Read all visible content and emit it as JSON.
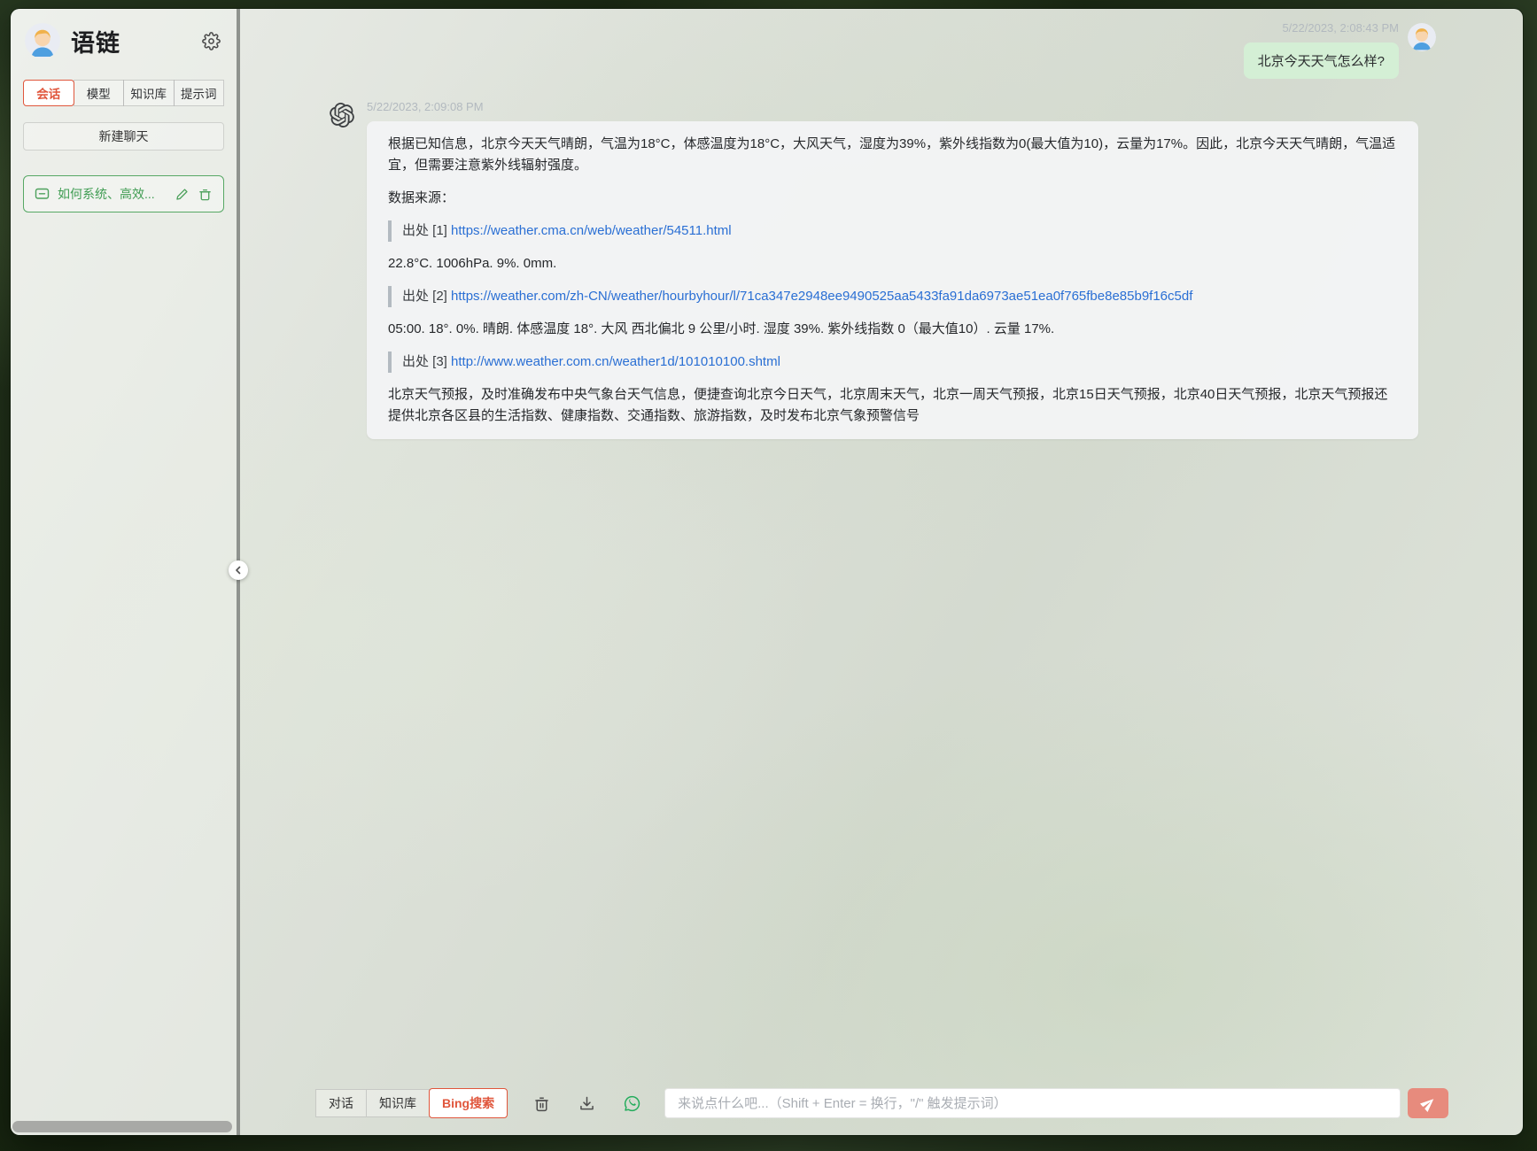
{
  "sidebar": {
    "app_title": "语链",
    "tabs": [
      {
        "label": "会话",
        "active": true
      },
      {
        "label": "模型",
        "active": false
      },
      {
        "label": "知识库",
        "active": false
      },
      {
        "label": "提示词",
        "active": false
      }
    ],
    "new_chat_label": "新建聊天",
    "conversations": [
      {
        "title": "如何系统、高效..."
      }
    ]
  },
  "chat": {
    "user_message": {
      "timestamp": "5/22/2023, 2:08:43 PM",
      "text": "北京今天天气怎么样?"
    },
    "assistant_message": {
      "timestamp": "5/22/2023, 2:09:08 PM",
      "paragraph1": "根据已知信息，北京今天天气晴朗，气温为18°C，体感温度为18°C，大风天气，湿度为39%，紫外线指数为0(最大值为10)，云量为17%。因此，北京今天天气晴朗，气温适宜，但需要注意紫外线辐射强度。",
      "sources_label": "数据来源：",
      "sources": [
        {
          "label": "出处 [1]",
          "url": "https://weather.cma.cn/web/weather/54511.html",
          "snippet": "22.8°C. 1006hPa. 9%. 0mm."
        },
        {
          "label": "出处 [2]",
          "url": "https://weather.com/zh-CN/weather/hourbyhour/l/71ca347e2948ee9490525aa5433fa91da6973ae51ea0f765fbe8e85b9f16c5df",
          "snippet": "05:00. 18°. 0%. 晴朗. 体感温度 18°. 大风 西北偏北 9 公里/小时. 湿度 39%. 紫外线指数 0（最大值10）. 云量 17%."
        },
        {
          "label": "出处 [3]",
          "url": "http://www.weather.com.cn/weather1d/101010100.shtml",
          "snippet": "北京天气预报，及时准确发布中央气象台天气信息，便捷查询北京今日天气，北京周末天气，北京一周天气预报，北京15日天气预报，北京40日天气预报，北京天气预报还提供北京各区县的生活指数、健康指数、交通指数、旅游指数，及时发布北京气象预警信号"
        }
      ]
    }
  },
  "toolbar": {
    "modes": [
      {
        "label": "对话",
        "active": false
      },
      {
        "label": "知识库",
        "active": false
      },
      {
        "label": "Bing搜索",
        "active": true
      }
    ],
    "input_placeholder": "来说点什么吧...（Shift + Enter = 换行，\"/\" 触发提示词）"
  },
  "colors": {
    "accent_red": "#e0563c",
    "accent_green": "#4da15c",
    "link_blue": "#2a6fd4",
    "user_bubble_green": "#d4efd5",
    "assistant_bubble_gray": "#f2f3f4",
    "send_button_salmon": "#e78b7d",
    "whatsapp_green": "#23ac5b"
  }
}
